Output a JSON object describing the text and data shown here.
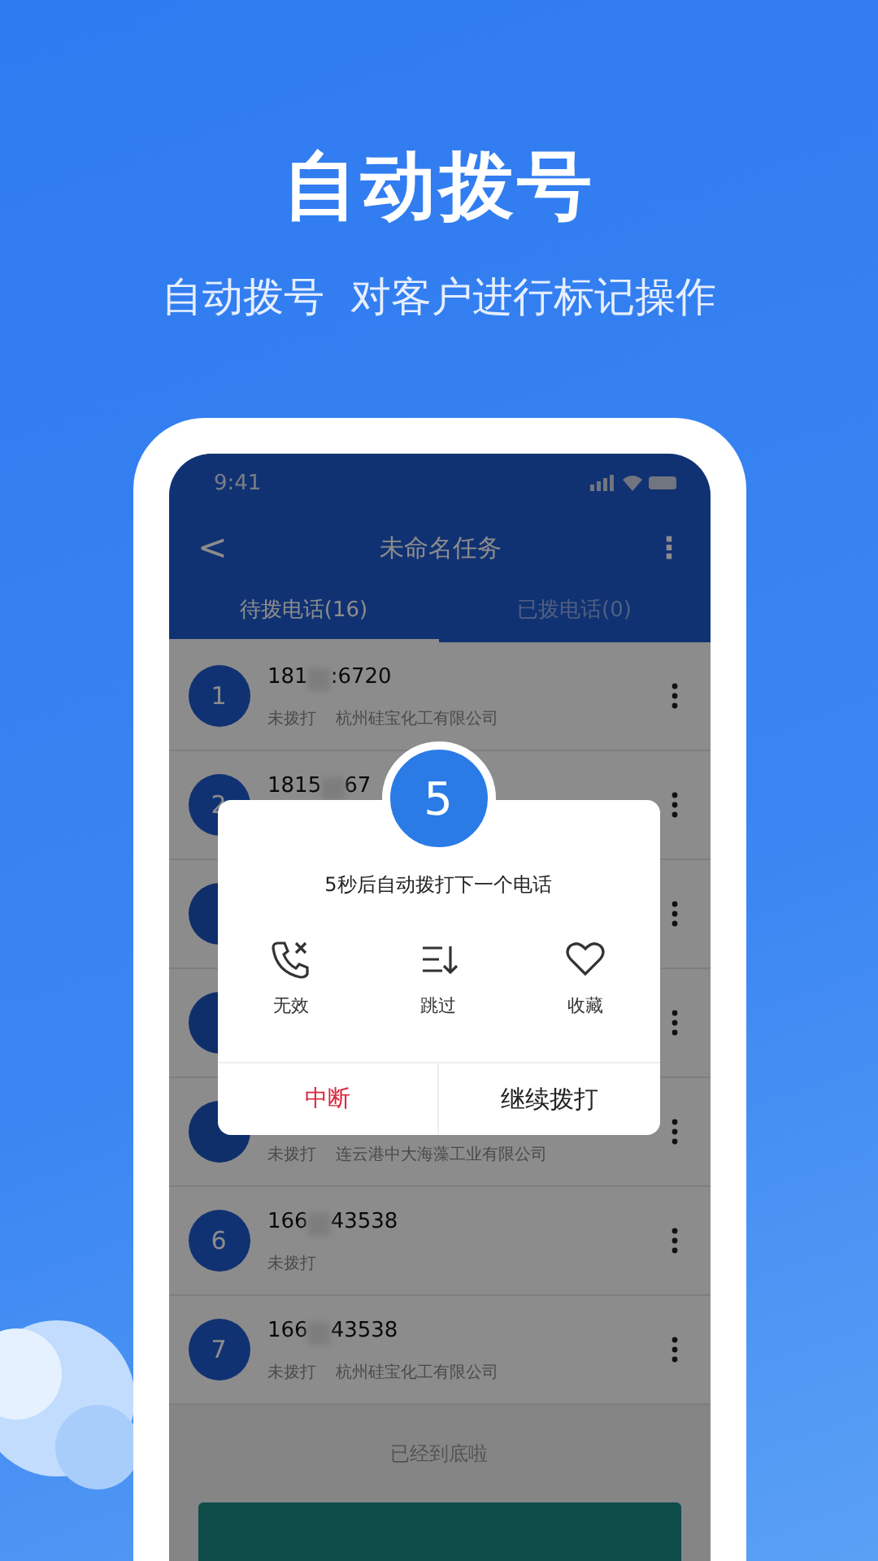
{
  "headline": "自动拨号",
  "subheadline": "自动拨号  对客户进行标记操作",
  "phone": {
    "status_bar": {
      "time": "9:41"
    },
    "nav": {
      "back": "<",
      "title": "未命名任务",
      "more": "⋮"
    },
    "tabs": [
      {
        "label": "待拨电话(16)",
        "selected": true
      },
      {
        "label": "已拨电话(0)",
        "selected": false
      }
    ],
    "calls": [
      {
        "index": "1",
        "number_start": "181",
        "number_end": ":6720",
        "status": "未拨打",
        "company": "杭州硅宝化工有限公司"
      },
      {
        "index": "2",
        "number_start": "1815",
        "number_end": "67"
      },
      {
        "kind": "covered"
      },
      {
        "kind": "covered"
      },
      {
        "kind": "covered",
        "status": "未拨打",
        "company": "连云港中大海藻工业有限公司"
      },
      {
        "index": "6",
        "number_start": "166",
        "number_end": "43538",
        "status": "未拨打"
      },
      {
        "index": "7",
        "number_start": "166",
        "number_end": "43538",
        "status": "未拨打",
        "company": "杭州硅宝化工有限公司"
      }
    ],
    "list_end": "已经到底啦",
    "dialog": {
      "countdown": "5",
      "message": "5秒后自动拨打下一个电话",
      "actions": [
        {
          "kind": "invalid",
          "label": "无效"
        },
        {
          "kind": "skip",
          "label": "跳过"
        },
        {
          "kind": "favorite",
          "label": "收藏"
        }
      ],
      "buttons": [
        {
          "kind": "danger",
          "label": "中断"
        },
        {
          "kind": "primary",
          "label": "继续拨打"
        }
      ]
    }
  }
}
